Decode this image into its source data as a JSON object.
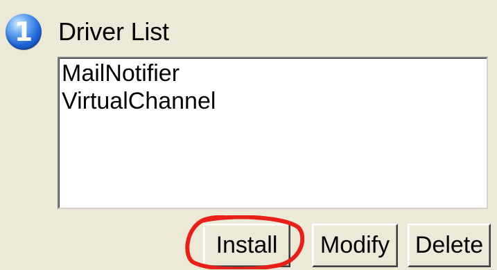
{
  "section": {
    "step_number": "1",
    "title": "Driver List",
    "icon": "step-number-icon"
  },
  "driver_list": {
    "items": [
      "MailNotifier",
      "VirtualChannel"
    ]
  },
  "buttons": {
    "install": "Install",
    "modify": "Modify",
    "delete": "Delete"
  },
  "annotation": {
    "highlight_color": "#e8201a",
    "highlights": "install-button"
  },
  "colors": {
    "window_bg": "#ECE9D8",
    "list_bg": "#FFFFFF",
    "icon_blue": "#1F64D6"
  }
}
